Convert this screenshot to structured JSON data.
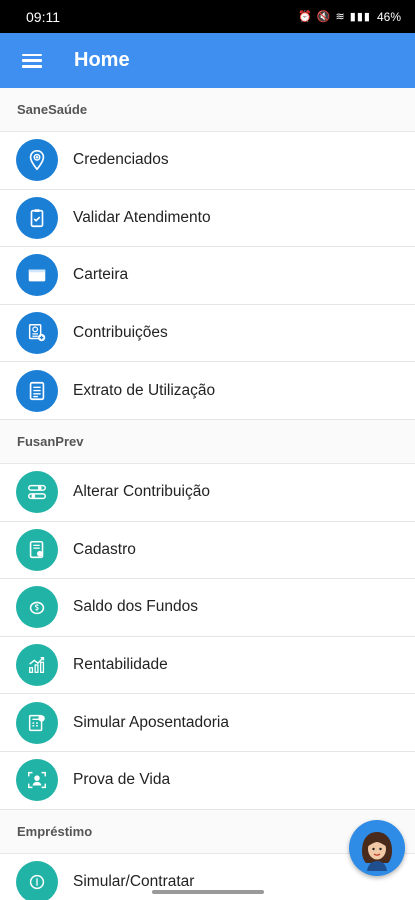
{
  "status": {
    "time": "09:11",
    "battery": "46%",
    "icons": "⏰ 🔇 ≋ ▮▮▮"
  },
  "app_bar": {
    "title": "Home"
  },
  "sections": [
    {
      "title": "SaneSaúde",
      "items": [
        {
          "label": "Credenciados",
          "icon": "location-pin-icon"
        },
        {
          "label": "Validar Atendimento",
          "icon": "clipboard-check-icon"
        },
        {
          "label": "Carteira",
          "icon": "wallet-icon"
        },
        {
          "label": "Contribuições",
          "icon": "contribution-doc-icon"
        },
        {
          "label": "Extrato de Utilização",
          "icon": "statement-icon"
        }
      ]
    },
    {
      "title": "FusanPrev",
      "items": [
        {
          "label": "Alterar Contribuição",
          "icon": "sliders-icon"
        },
        {
          "label": "Cadastro",
          "icon": "profile-card-icon"
        },
        {
          "label": "Saldo dos Fundos",
          "icon": "piggy-bank-icon"
        },
        {
          "label": "Rentabilidade",
          "icon": "growth-chart-icon"
        },
        {
          "label": "Simular Aposentadoria",
          "icon": "calculator-icon"
        },
        {
          "label": "Prova de Vida",
          "icon": "face-scan-icon"
        }
      ]
    },
    {
      "title": "Empréstimo",
      "items": [
        {
          "label": "Simular/Contratar",
          "icon": "money-icon"
        }
      ]
    }
  ],
  "colors": {
    "app_bar": "#3f8ff0",
    "icon_blue": "#1b7fd6",
    "icon_teal": "#22b3a7"
  }
}
